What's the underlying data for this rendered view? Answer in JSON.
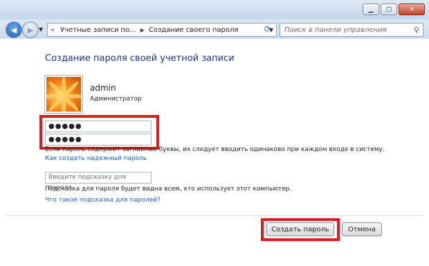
{
  "window": {
    "minimize_icon": "minimize-icon",
    "maximize_icon": "maximize-icon",
    "close_icon": "close-icon"
  },
  "nav": {
    "breadcrumb": [
      "Учетные записи по...",
      "Создание своего пароля"
    ],
    "search_placeholder": "Поиск в панели управления"
  },
  "page": {
    "title": "Создание пароля своей учетной записи",
    "user": {
      "name": "admin",
      "role": "Администратор"
    },
    "password": "●●●●●",
    "confirm": "●●●●●",
    "case_note": "Если пароль содержит заглавные буквы, их следует вводить одинаково при каждом входе в систему.",
    "strong_link": "Как создать надежный пароль",
    "hint_placeholder": "Введите подсказку для пароля",
    "hint_note": "Подсказка для пароля будет видна всем, кто использует этот компьютер.",
    "hint_link": "Что такое подсказка для паролей?"
  },
  "buttons": {
    "create": "Создать пароль",
    "cancel": "Отмена"
  },
  "colors": {
    "title": "#1e3287",
    "link": "#1a5fc0",
    "highlight": "#e01b1b"
  }
}
